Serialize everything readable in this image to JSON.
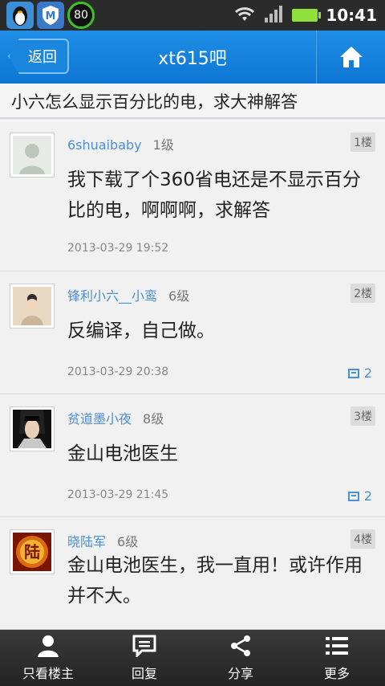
{
  "status": {
    "battery_level": 1.0,
    "score": "80",
    "time": "10:41"
  },
  "header": {
    "back_label": "返回",
    "title": "xt615吧"
  },
  "thread": {
    "title": "小六怎么显示百分比的电，求大神解答"
  },
  "posts": [
    {
      "author": "6shuaibaby",
      "level": "1级",
      "floor": "1楼",
      "content": "我下载了个360省电还是不显示百分比的电，啊啊啊，求解答",
      "time": "2013-03-29 19:52",
      "replies": ""
    },
    {
      "author": "锋利小六__小鸾",
      "level": "6级",
      "floor": "2楼",
      "content": "反编译，自己做。",
      "time": "2013-03-29 20:38",
      "replies": "2"
    },
    {
      "author": "贫道墨小夜",
      "level": "8级",
      "floor": "3楼",
      "content": "金山电池医生",
      "time": "2013-03-29 21:45",
      "replies": "2"
    },
    {
      "author": "晓陆军",
      "level": "6级",
      "floor": "4楼",
      "content": "金山电池医生，我一直用！或许作用并不大。",
      "time": "",
      "replies": ""
    }
  ],
  "avatar4_glyph": "陆",
  "bottombar": {
    "author_only": "只看楼主",
    "reply": "回复",
    "share": "分享",
    "more": "更多"
  }
}
